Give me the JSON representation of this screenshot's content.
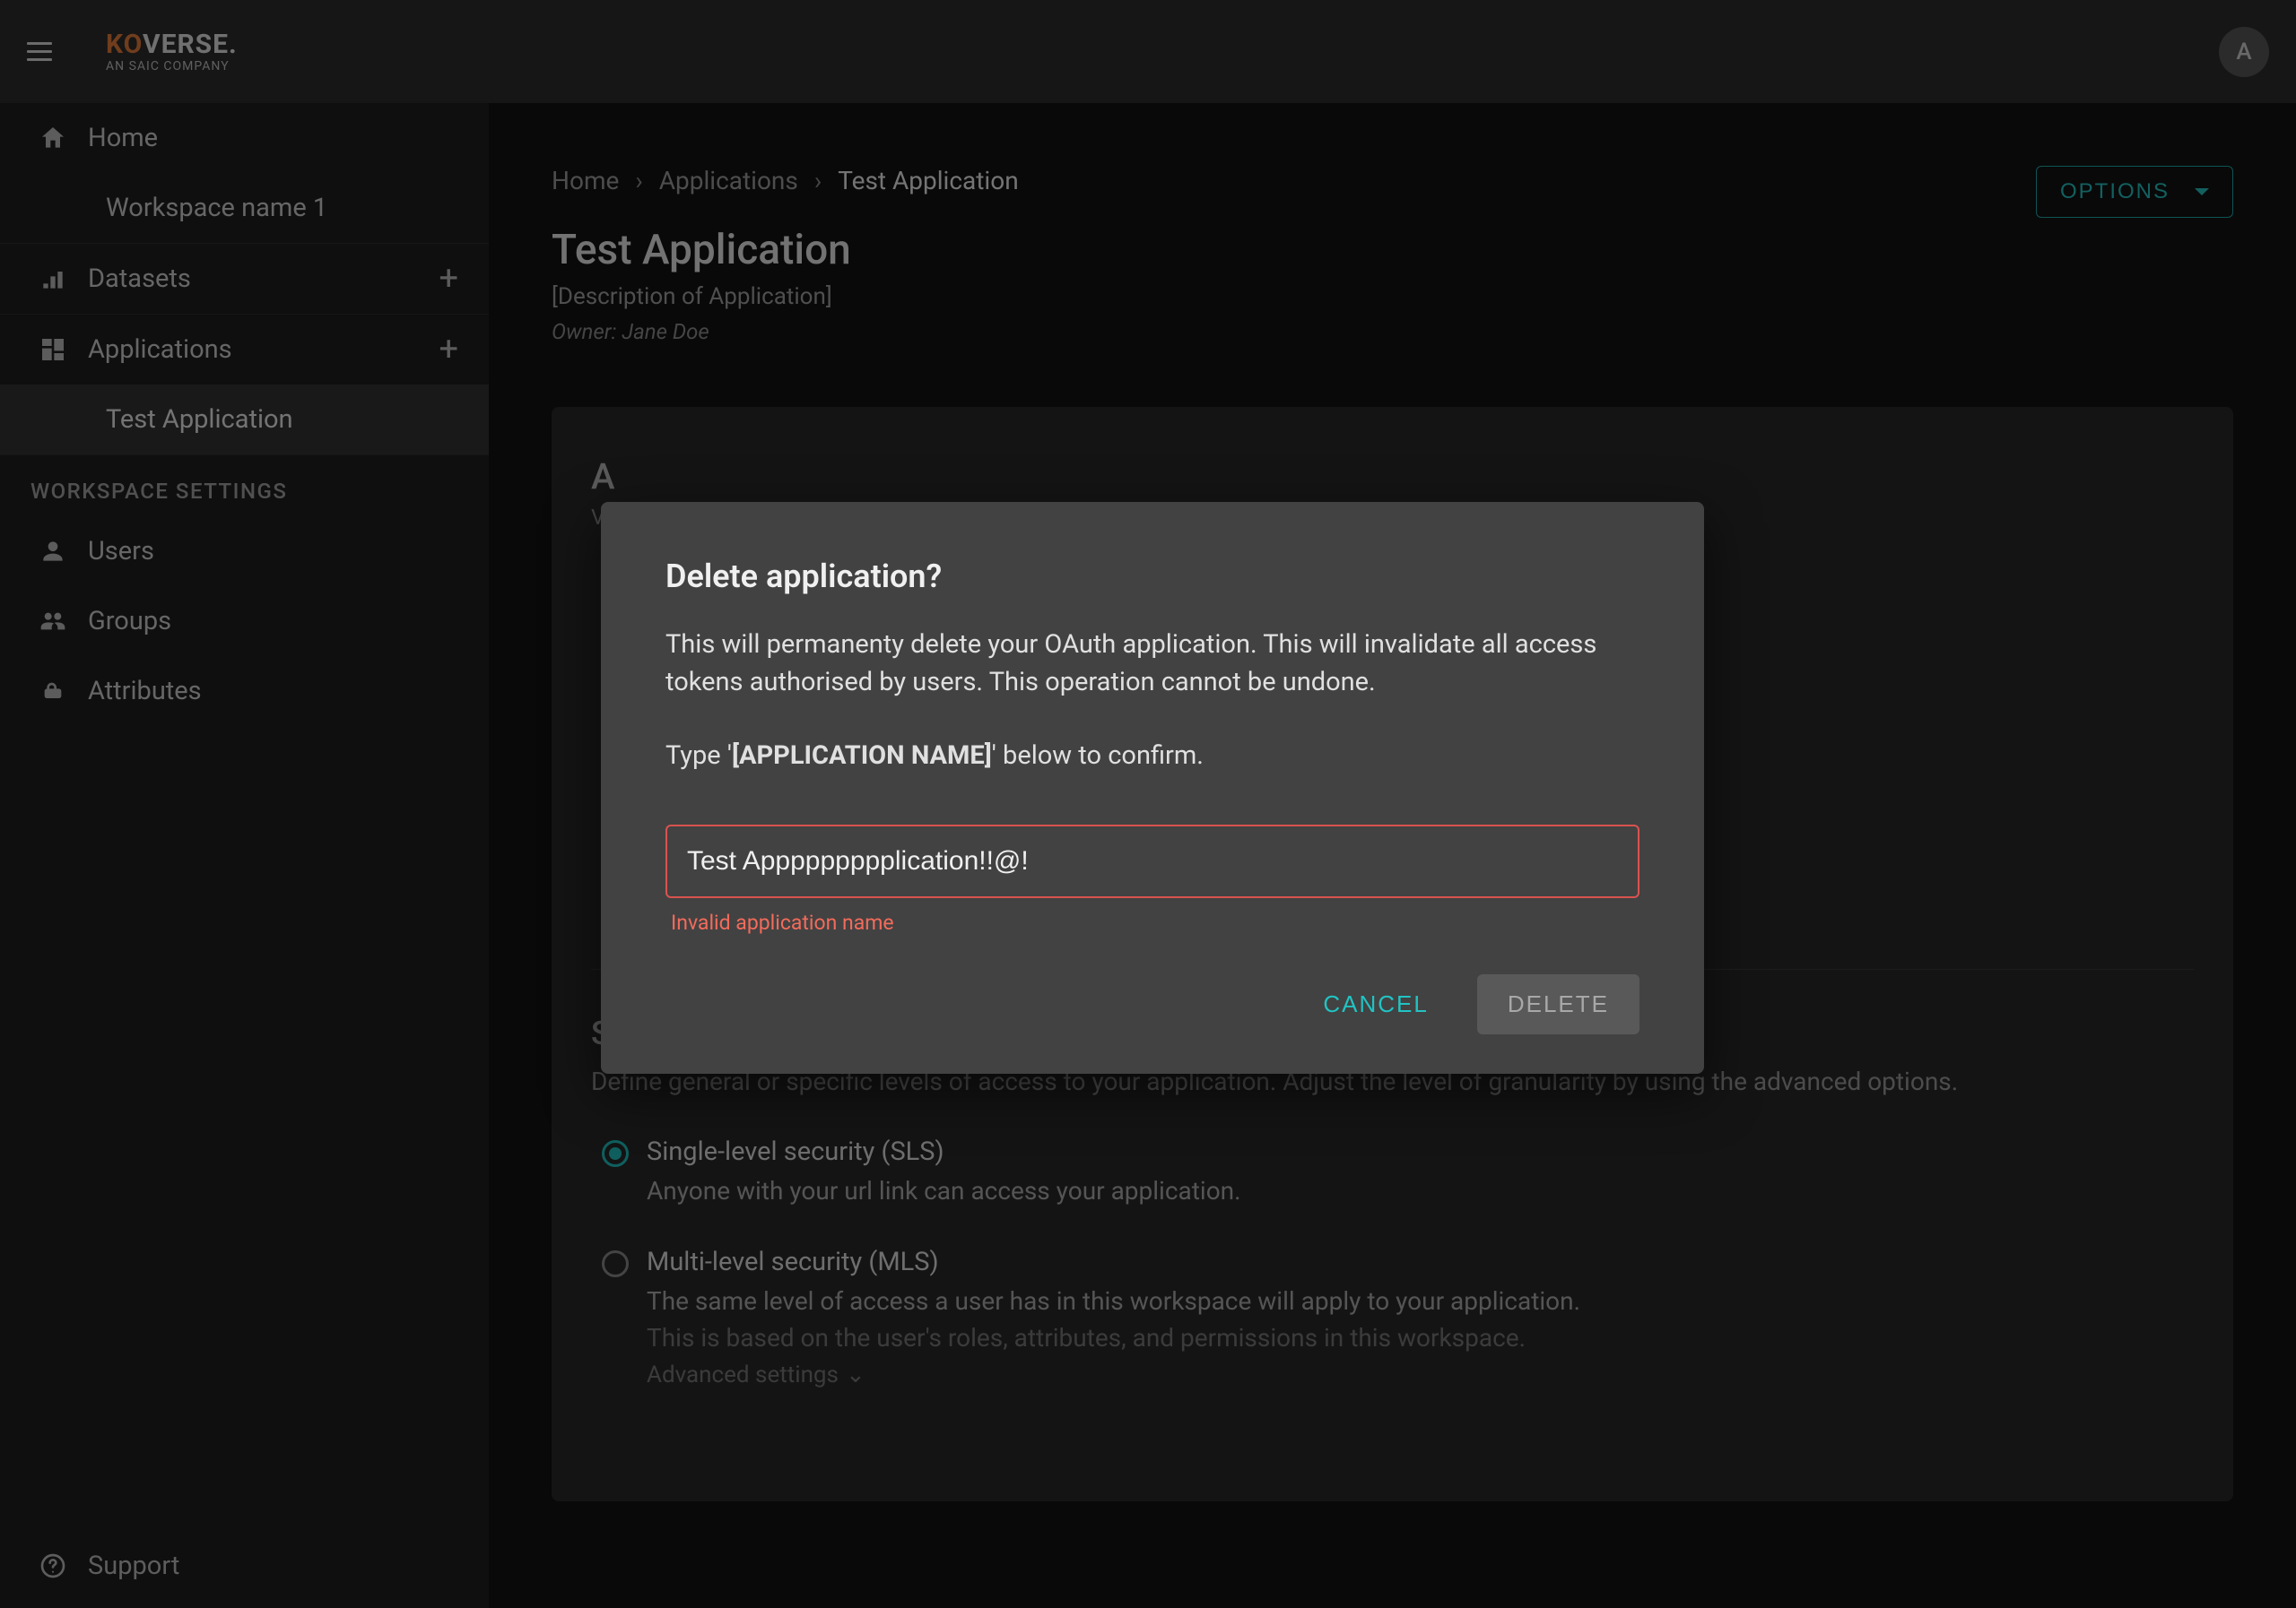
{
  "brand": {
    "prefix": "KO",
    "suffix": "VERSE",
    "tagline": "AN SAIC COMPANY"
  },
  "avatar_initial": "A",
  "sidebar": {
    "home": "Home",
    "workspace_name": "Workspace name 1",
    "datasets": "Datasets",
    "applications": "Applications",
    "test_application": "Test Application",
    "section_label": "WORKSPACE SETTINGS",
    "users": "Users",
    "groups": "Groups",
    "attributes": "Attributes",
    "support": "Support"
  },
  "breadcrumb": {
    "home": "Home",
    "applications": "Applications",
    "current": "Test Application"
  },
  "options_label": "OPTIONS",
  "page": {
    "title": "Test Application",
    "description": "[Description of Application]",
    "owner": "Owner: Jane Doe"
  },
  "card": {
    "hidden_title_initial": "A",
    "hidden_hint_initial": "V",
    "security_title": "Security level",
    "security_desc": "Define general or specific levels of access to your application. Adjust the level of granularity by using the advanced options.",
    "sls_label": "Single-level security (SLS)",
    "sls_desc": "Anyone with your url link can access your application.",
    "mls_label": "Multi-level security (MLS)",
    "mls_desc": "The same level of access a user has in this workspace will apply to your application.",
    "mls_sub": "This is based on the user's roles, attributes, and permissions in this workspace.",
    "advanced": "Advanced settings"
  },
  "dialog": {
    "title": "Delete application?",
    "body1": "This will permanenty delete your OAuth application. This will invalidate all access tokens authorised by users. This operation cannot be undone.",
    "confirm_prefix": "Type '",
    "confirm_strong": "[APPLICATION NAME]",
    "confirm_suffix": "' below to confirm.",
    "input_value": "Test Appppppppplication!!@!",
    "error": "Invalid application name",
    "cancel": "CANCEL",
    "delete": "DELETE"
  }
}
